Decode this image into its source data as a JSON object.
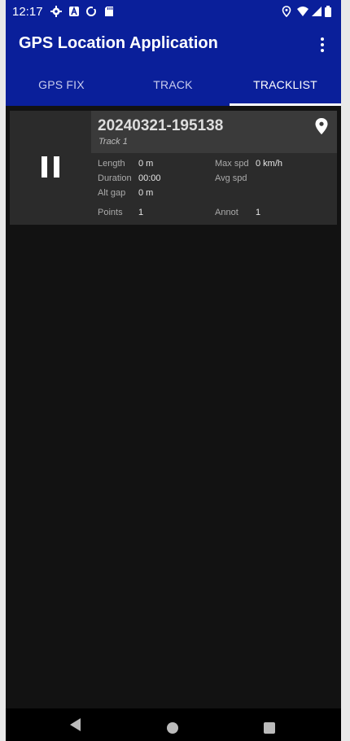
{
  "status_bar": {
    "time": "12:17",
    "icons": [
      "gear-icon",
      "a-icon",
      "sync-icon",
      "sd-card-icon",
      "location-icon",
      "wifi-icon",
      "signal-icon",
      "battery-icon"
    ]
  },
  "app_bar": {
    "title": "GPS Location Application",
    "menu_icon": "more-vert-icon"
  },
  "tabs": [
    {
      "label": "GPS FIX"
    },
    {
      "label": "TRACK"
    },
    {
      "label": "TRACKLIST"
    }
  ],
  "active_tab": "TRACKLIST",
  "track": {
    "name": "20240321-195138",
    "subtitle": "Track 1",
    "control_icon": "pause-icon",
    "stats": {
      "length_label": "Length",
      "length_value": "0 m",
      "maxspd_label": "Max spd",
      "maxspd_value": "0 km/h",
      "duration_label": "Duration",
      "duration_value": "00:00",
      "avgspd_label": "Avg spd",
      "avgspd_value": "",
      "altgap_label": "Alt gap",
      "altgap_value": "0 m",
      "points_label": "Points",
      "points_value": "1",
      "annot_label": "Annot",
      "annot_value": "1"
    }
  },
  "colors": {
    "app_bar": "#0a1f9a",
    "background": "#121212",
    "card": "#2b2b2b",
    "card_header": "#3a3a3a"
  }
}
